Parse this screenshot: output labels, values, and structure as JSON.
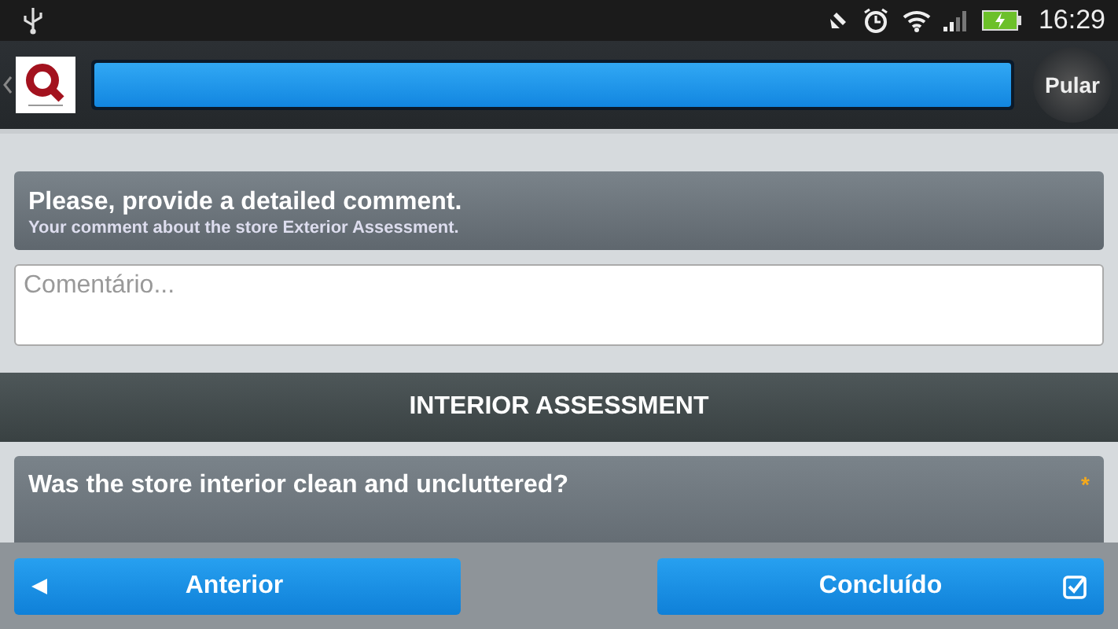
{
  "status_bar": {
    "time": "16:29"
  },
  "app_bar": {
    "progress": {
      "level": 1
    },
    "skip_button": "Pular"
  },
  "comment_card": {
    "title": "Please, provide a detailed comment.",
    "subtitle": "Your comment about the store Exterior Assessment.",
    "field": {
      "placeholder": "Comentário..."
    }
  },
  "section_header": "INTERIOR ASSESSMENT",
  "question_card": {
    "question": "Was the store interior clean and uncluttered?",
    "required_mark": "*"
  },
  "footer": {
    "previous_button": "Anterior",
    "done_button": "Concluído"
  }
}
